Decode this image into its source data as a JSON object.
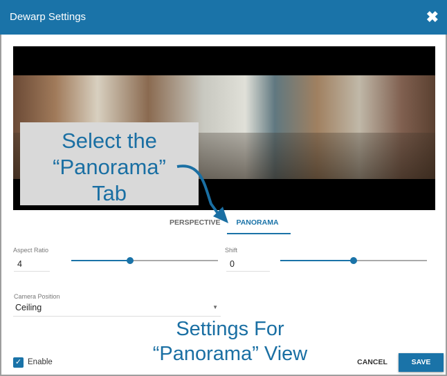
{
  "dialog": {
    "title": "Dewarp Settings"
  },
  "tabs": [
    {
      "label": "PERSPECTIVE"
    },
    {
      "label": "PANORAMA",
      "active": true
    }
  ],
  "annotations": {
    "select_tab": [
      "Select the",
      "“Panorama”",
      "Tab"
    ],
    "settings": [
      "Settings For",
      "“Panorama” View"
    ]
  },
  "aspect_ratio": {
    "label": "Aspect Ratio",
    "value": "4",
    "slider_fraction": 0.4
  },
  "shift": {
    "label": "Shift",
    "value": "0",
    "slider_fraction": 0.5
  },
  "camera_position": {
    "label": "Camera Position",
    "value": "Ceiling"
  },
  "enable": {
    "label": "Enable",
    "checked": true
  },
  "buttons": {
    "cancel": "CANCEL",
    "save": "SAVE"
  },
  "colors": {
    "accent": "#1a73a8"
  }
}
